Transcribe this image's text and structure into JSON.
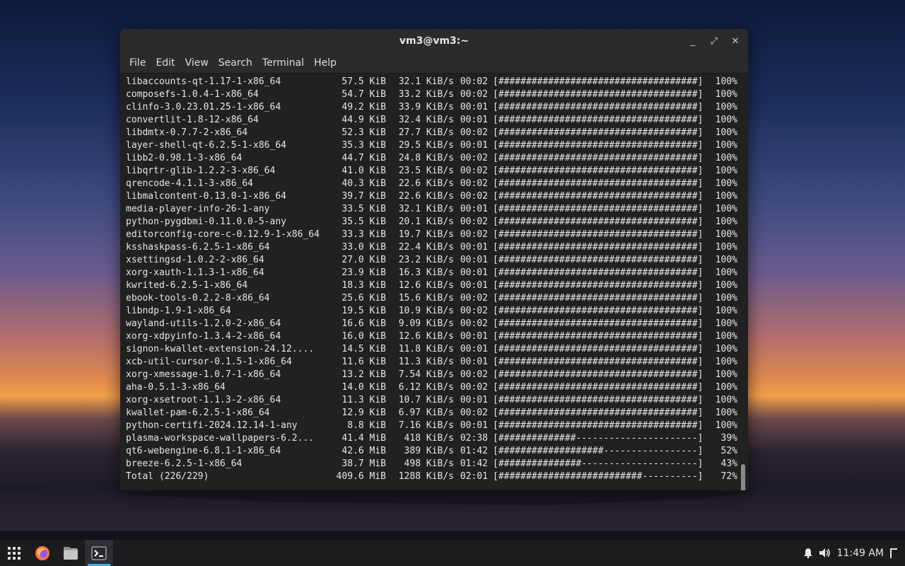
{
  "window": {
    "title": "vm3@vm3:~",
    "controls": {
      "minimize": "_",
      "maximize": "⤢",
      "close": "✕"
    }
  },
  "menu": [
    "File",
    "Edit",
    "View",
    "Search",
    "Terminal",
    "Help"
  ],
  "rows": [
    {
      "name": "libaccounts-qt-1.17-1-x86_64",
      "size": "57.5 KiB",
      "rate": "32.1 KiB/s",
      "time": "00:02",
      "bar": "[####################################]",
      "pct": "100%"
    },
    {
      "name": "composefs-1.0.4-1-x86_64",
      "size": "54.7 KiB",
      "rate": "33.2 KiB/s",
      "time": "00:02",
      "bar": "[####################################]",
      "pct": "100%"
    },
    {
      "name": "clinfo-3.0.23.01.25-1-x86_64",
      "size": "49.2 KiB",
      "rate": "33.9 KiB/s",
      "time": "00:01",
      "bar": "[####################################]",
      "pct": "100%"
    },
    {
      "name": "convertlit-1.8-12-x86_64",
      "size": "44.9 KiB",
      "rate": "32.4 KiB/s",
      "time": "00:01",
      "bar": "[####################################]",
      "pct": "100%"
    },
    {
      "name": "libdmtx-0.7.7-2-x86_64",
      "size": "52.3 KiB",
      "rate": "27.7 KiB/s",
      "time": "00:02",
      "bar": "[####################################]",
      "pct": "100%"
    },
    {
      "name": "layer-shell-qt-6.2.5-1-x86_64",
      "size": "35.3 KiB",
      "rate": "29.5 KiB/s",
      "time": "00:01",
      "bar": "[####################################]",
      "pct": "100%"
    },
    {
      "name": "libb2-0.98.1-3-x86_64",
      "size": "44.7 KiB",
      "rate": "24.8 KiB/s",
      "time": "00:02",
      "bar": "[####################################]",
      "pct": "100%"
    },
    {
      "name": "libqrtr-glib-1.2.2-3-x86_64",
      "size": "41.0 KiB",
      "rate": "23.5 KiB/s",
      "time": "00:02",
      "bar": "[####################################]",
      "pct": "100%"
    },
    {
      "name": "qrencode-4.1.1-3-x86_64",
      "size": "40.3 KiB",
      "rate": "22.6 KiB/s",
      "time": "00:02",
      "bar": "[####################################]",
      "pct": "100%"
    },
    {
      "name": "libmalcontent-0.13.0-1-x86_64",
      "size": "39.7 KiB",
      "rate": "22.6 KiB/s",
      "time": "00:02",
      "bar": "[####################################]",
      "pct": "100%"
    },
    {
      "name": "media-player-info-26-1-any",
      "size": "33.5 KiB",
      "rate": "32.1 KiB/s",
      "time": "00:01",
      "bar": "[####################################]",
      "pct": "100%"
    },
    {
      "name": "python-pygdbmi-0.11.0.0-5-any",
      "size": "35.5 KiB",
      "rate": "20.1 KiB/s",
      "time": "00:02",
      "bar": "[####################################]",
      "pct": "100%"
    },
    {
      "name": "editorconfig-core-c-0.12.9-1-x86_64",
      "size": "33.3 KiB",
      "rate": "19.7 KiB/s",
      "time": "00:02",
      "bar": "[####################################]",
      "pct": "100%"
    },
    {
      "name": "ksshaskpass-6.2.5-1-x86_64",
      "size": "33.0 KiB",
      "rate": "22.4 KiB/s",
      "time": "00:01",
      "bar": "[####################################]",
      "pct": "100%"
    },
    {
      "name": "xsettingsd-1.0.2-2-x86_64",
      "size": "27.0 KiB",
      "rate": "23.2 KiB/s",
      "time": "00:01",
      "bar": "[####################################]",
      "pct": "100%"
    },
    {
      "name": "xorg-xauth-1.1.3-1-x86_64",
      "size": "23.9 KiB",
      "rate": "16.3 KiB/s",
      "time": "00:01",
      "bar": "[####################################]",
      "pct": "100%"
    },
    {
      "name": "kwrited-6.2.5-1-x86_64",
      "size": "18.3 KiB",
      "rate": "12.6 KiB/s",
      "time": "00:01",
      "bar": "[####################################]",
      "pct": "100%"
    },
    {
      "name": "ebook-tools-0.2.2-8-x86_64",
      "size": "25.6 KiB",
      "rate": "15.6 KiB/s",
      "time": "00:02",
      "bar": "[####################################]",
      "pct": "100%"
    },
    {
      "name": "libndp-1.9-1-x86_64",
      "size": "19.5 KiB",
      "rate": "10.9 KiB/s",
      "time": "00:02",
      "bar": "[####################################]",
      "pct": "100%"
    },
    {
      "name": "wayland-utils-1.2.0-2-x86_64",
      "size": "16.6 KiB",
      "rate": "9.09 KiB/s",
      "time": "00:02",
      "bar": "[####################################]",
      "pct": "100%"
    },
    {
      "name": "xorg-xdpyinfo-1.3.4-2-x86_64",
      "size": "16.0 KiB",
      "rate": "12.6 KiB/s",
      "time": "00:01",
      "bar": "[####################################]",
      "pct": "100%"
    },
    {
      "name": "signon-kwallet-extension-24.12....",
      "size": "14.5 KiB",
      "rate": "11.8 KiB/s",
      "time": "00:01",
      "bar": "[####################################]",
      "pct": "100%"
    },
    {
      "name": "xcb-util-cursor-0.1.5-1-x86_64",
      "size": "11.6 KiB",
      "rate": "11.3 KiB/s",
      "time": "00:01",
      "bar": "[####################################]",
      "pct": "100%"
    },
    {
      "name": "xorg-xmessage-1.0.7-1-x86_64",
      "size": "13.2 KiB",
      "rate": "7.54 KiB/s",
      "time": "00:02",
      "bar": "[####################################]",
      "pct": "100%"
    },
    {
      "name": "aha-0.5.1-3-x86_64",
      "size": "14.0 KiB",
      "rate": "6.12 KiB/s",
      "time": "00:02",
      "bar": "[####################################]",
      "pct": "100%"
    },
    {
      "name": "xorg-xsetroot-1.1.3-2-x86_64",
      "size": "11.3 KiB",
      "rate": "10.7 KiB/s",
      "time": "00:01",
      "bar": "[####################################]",
      "pct": "100%"
    },
    {
      "name": "kwallet-pam-6.2.5-1-x86_64",
      "size": "12.9 KiB",
      "rate": "6.97 KiB/s",
      "time": "00:02",
      "bar": "[####################################]",
      "pct": "100%"
    },
    {
      "name": "python-certifi-2024.12.14-1-any",
      "size": "8.8 KiB",
      "rate": "7.16 KiB/s",
      "time": "00:01",
      "bar": "[####################################]",
      "pct": "100%"
    },
    {
      "name": "plasma-workspace-wallpapers-6.2...",
      "size": "41.4 MiB",
      "rate": "418 KiB/s",
      "time": "02:38",
      "bar": "[##############----------------------]",
      "pct": "39%"
    },
    {
      "name": "qt6-webengine-6.8.1-1-x86_64",
      "size": "42.6 MiB",
      "rate": "389 KiB/s",
      "time": "01:42",
      "bar": "[###################-----------------]",
      "pct": "52%"
    },
    {
      "name": "breeze-6.2.5-1-x86_64",
      "size": "38.7 MiB",
      "rate": "498 KiB/s",
      "time": "01:42",
      "bar": "[###############---------------------]",
      "pct": "43%"
    },
    {
      "name": "Total (226/229)",
      "size": "409.6 MiB",
      "rate": "1288 KiB/s",
      "time": "02:01",
      "bar": "[##########################----------]",
      "pct": "72%"
    }
  ],
  "taskbar": {
    "apps": [
      "app-launcher-icon",
      "firefox-icon",
      "file-manager-icon",
      "terminal-icon"
    ],
    "clock": "11:49 AM"
  }
}
